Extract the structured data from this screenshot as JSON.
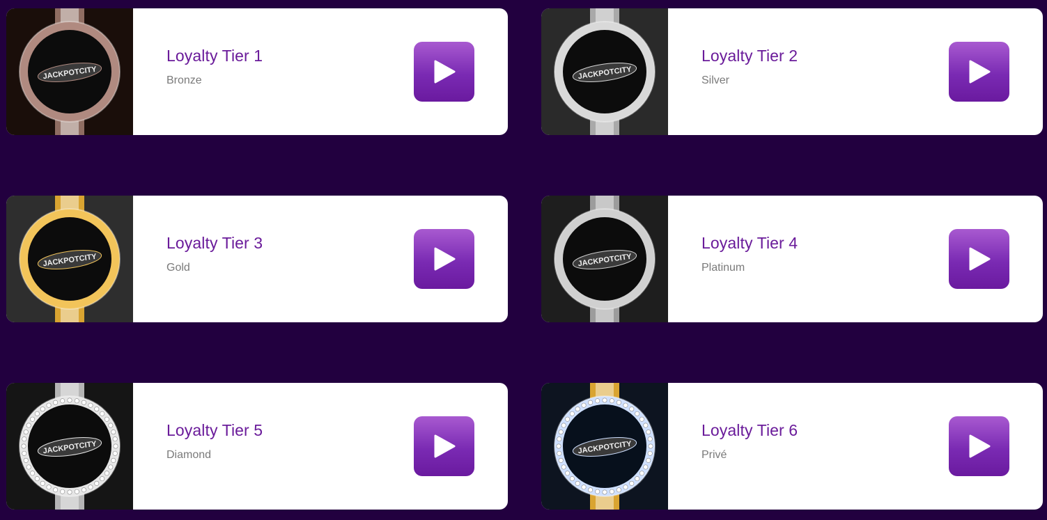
{
  "tiers": [
    {
      "title": "Loyalty Tier 1",
      "subtitle": "Bronze",
      "badge_icon": "bronze-badge-icon",
      "ring_color": "#b08a80",
      "strap_color": "#8f6d62",
      "bg_color": "#1a0e0a"
    },
    {
      "title": "Loyalty Tier 2",
      "subtitle": "Silver",
      "badge_icon": "silver-badge-icon",
      "ring_color": "#d9d9d9",
      "strap_color": "#a9a9a9",
      "bg_color": "#2a2a2a"
    },
    {
      "title": "Loyalty Tier 3",
      "subtitle": "Gold",
      "badge_icon": "gold-badge-icon",
      "ring_color": "#f2c45a",
      "strap_color": "#d9a431",
      "bg_color": "#2e2e2e"
    },
    {
      "title": "Loyalty Tier 4",
      "subtitle": "Platinum",
      "badge_icon": "platinum-badge-icon",
      "ring_color": "#d0d0d0",
      "strap_color": "#9c9c9c",
      "bg_color": "#1e1e1e"
    },
    {
      "title": "Loyalty Tier 5",
      "subtitle": "Diamond",
      "badge_icon": "diamond-badge-icon",
      "ring_color": "#e6e6e6",
      "strap_color": "#b5b5b5",
      "bg_color": "#151515"
    },
    {
      "title": "Loyalty Tier 6",
      "subtitle": "Privé",
      "badge_icon": "prive-badge-icon",
      "ring_color": "#cfe0ff",
      "strap_color": "#d9a431",
      "bg_color": "#0d1420"
    }
  ],
  "badge_logo_text": "JACKPOTCITY",
  "colors": {
    "page_bg": "#22003f",
    "title": "#6a1b9a",
    "subtitle": "#7a7a7a",
    "play_button": "#8a2fc0"
  },
  "icons": {
    "play": "play-icon"
  }
}
